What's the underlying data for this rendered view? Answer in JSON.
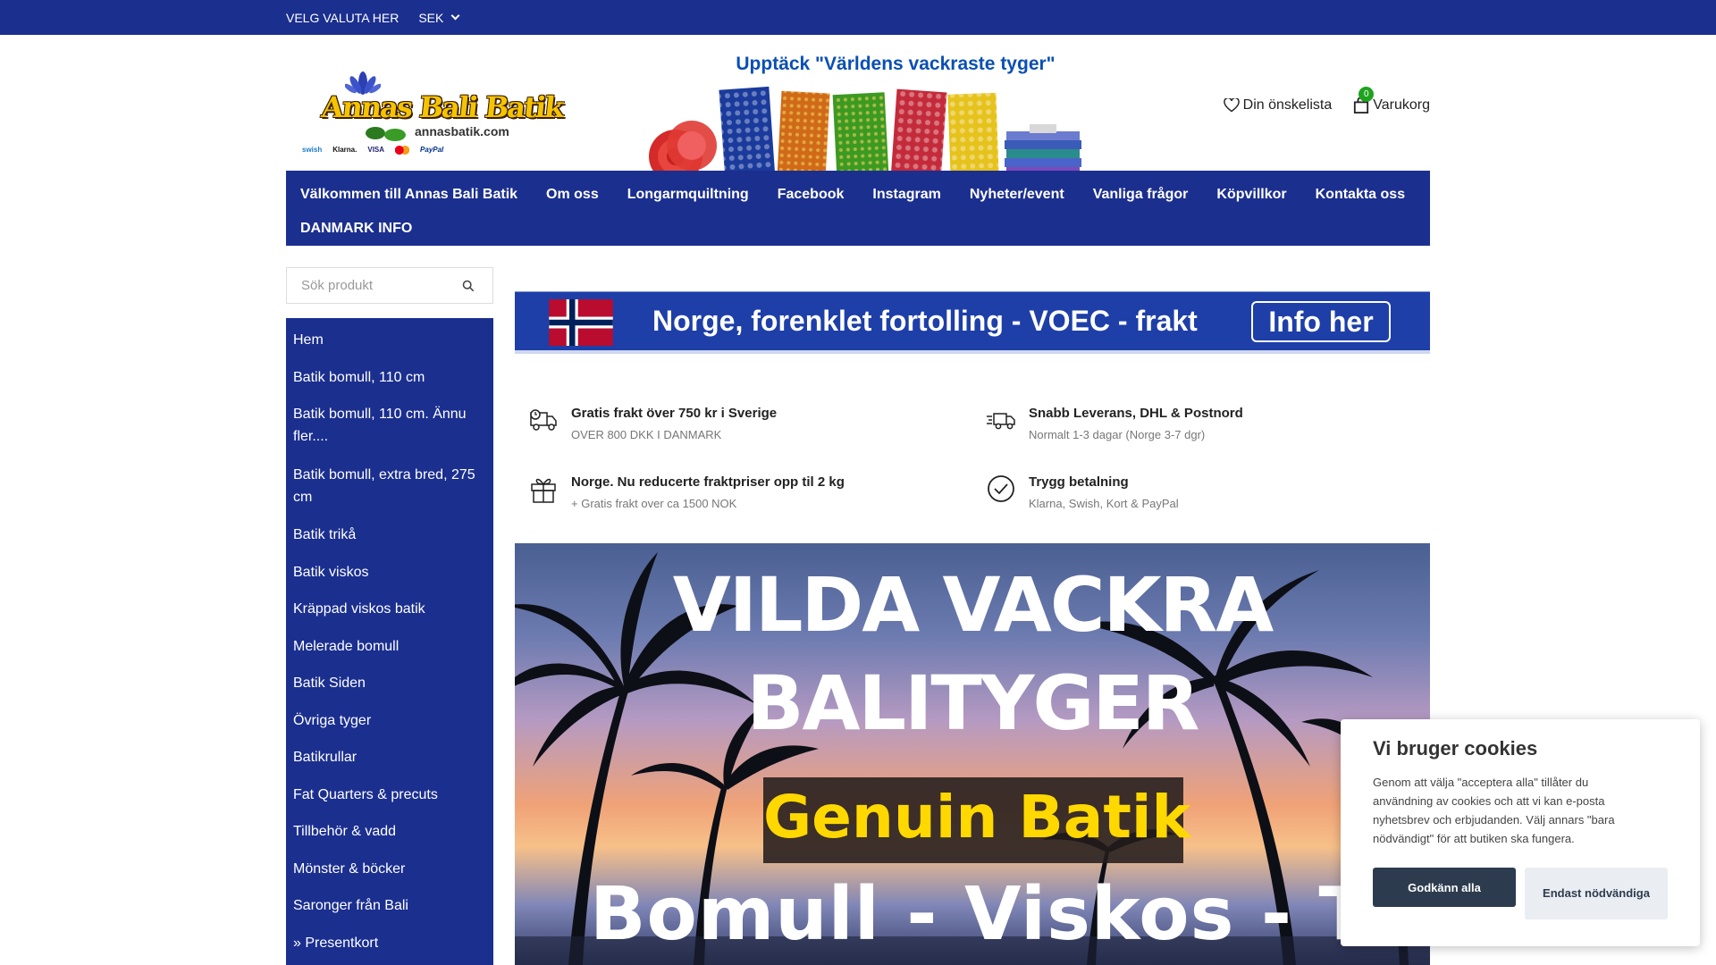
{
  "topbar": {
    "currency_label": "VELG VALUTA HER",
    "currency_value": "SEK"
  },
  "logo": {
    "title": "Annas Bali Batik",
    "url": "annasbatik.com",
    "payments": [
      "swish",
      "Klarna.",
      "VISA",
      "",
      "PayPal"
    ]
  },
  "promo": {
    "title": "Upptäck \"Världens vackraste tyger\""
  },
  "header_actions": {
    "wishlist_label": "Din önskelista",
    "cart_label": "Varukorg",
    "cart_count": "0"
  },
  "main_nav": [
    "Välkommen till Annas Bali Batik",
    "Om oss",
    "Longarmquiltning",
    "Facebook",
    "Instagram",
    "Nyheter/event",
    "Vanliga frågor",
    "Köpvillkor",
    "Kontakta oss",
    "DANMARK INFO"
  ],
  "search": {
    "placeholder": "Sök produkt"
  },
  "side_nav": [
    "Hem",
    "Batik bomull, 110 cm",
    "Batik bomull, 110 cm. Ännu fler....",
    "Batik bomull, extra bred, 275 cm",
    "Batik trikå",
    "Batik viskos",
    "Kräppad viskos batik",
    "Melerade bomull",
    "Batik Siden",
    "Övriga tyger",
    "Batikrullar",
    "Fat Quarters & precuts",
    "Tillbehör & vadd",
    "Mönster & böcker",
    "Saronger från Bali",
    "» Presentkort"
  ],
  "notice": {
    "message": "Norge, forenklet fortolling - VOEC - frakt",
    "button": "Info her"
  },
  "usps": [
    {
      "icon": "truck-icon",
      "title": "Gratis frakt över 750 kr i Sverige",
      "subtitle": "OVER 800 DKK I DANMARK"
    },
    {
      "icon": "fast-delivery-icon",
      "title": "Snabb Leverans, DHL & Postnord",
      "subtitle": "Normalt 1-3 dagar (Norge 3-7 dgr)"
    },
    {
      "icon": "gift-icon",
      "title": "Norge. Nu reducerte fraktpriser opp til 2 kg",
      "subtitle": "+ Gratis frakt over ca 1500 NOK"
    },
    {
      "icon": "check-circle-icon",
      "title": "Trygg betalning",
      "subtitle": "Klarna, Swish, Kort & PayPal"
    }
  ],
  "hero": {
    "line1": "VILDA VACKRA",
    "line2": "BALITYGER",
    "line3": "Genuin Batik",
    "line4": "Bomull - Viskos - Trikå"
  },
  "cookie": {
    "title": "Vi bruger cookies",
    "body": "Genom att välja \"acceptera alla\" tillåter du användning av cookies och att vi kan e-posta nyhetsbrev och erbjudanden. Välj annars \"bara nödvändigt\" för att butiken ska fungera.",
    "accept": "Godkänn alla",
    "necessary": "Endast nödvändiga"
  },
  "colors": {
    "brand_blue": "#1b2f8f",
    "notice_blue": "#1e3fa8",
    "promo_blue": "#0a4fb5",
    "cart_badge": "#1fa31f",
    "cookie_button": "#2d3b4f"
  }
}
